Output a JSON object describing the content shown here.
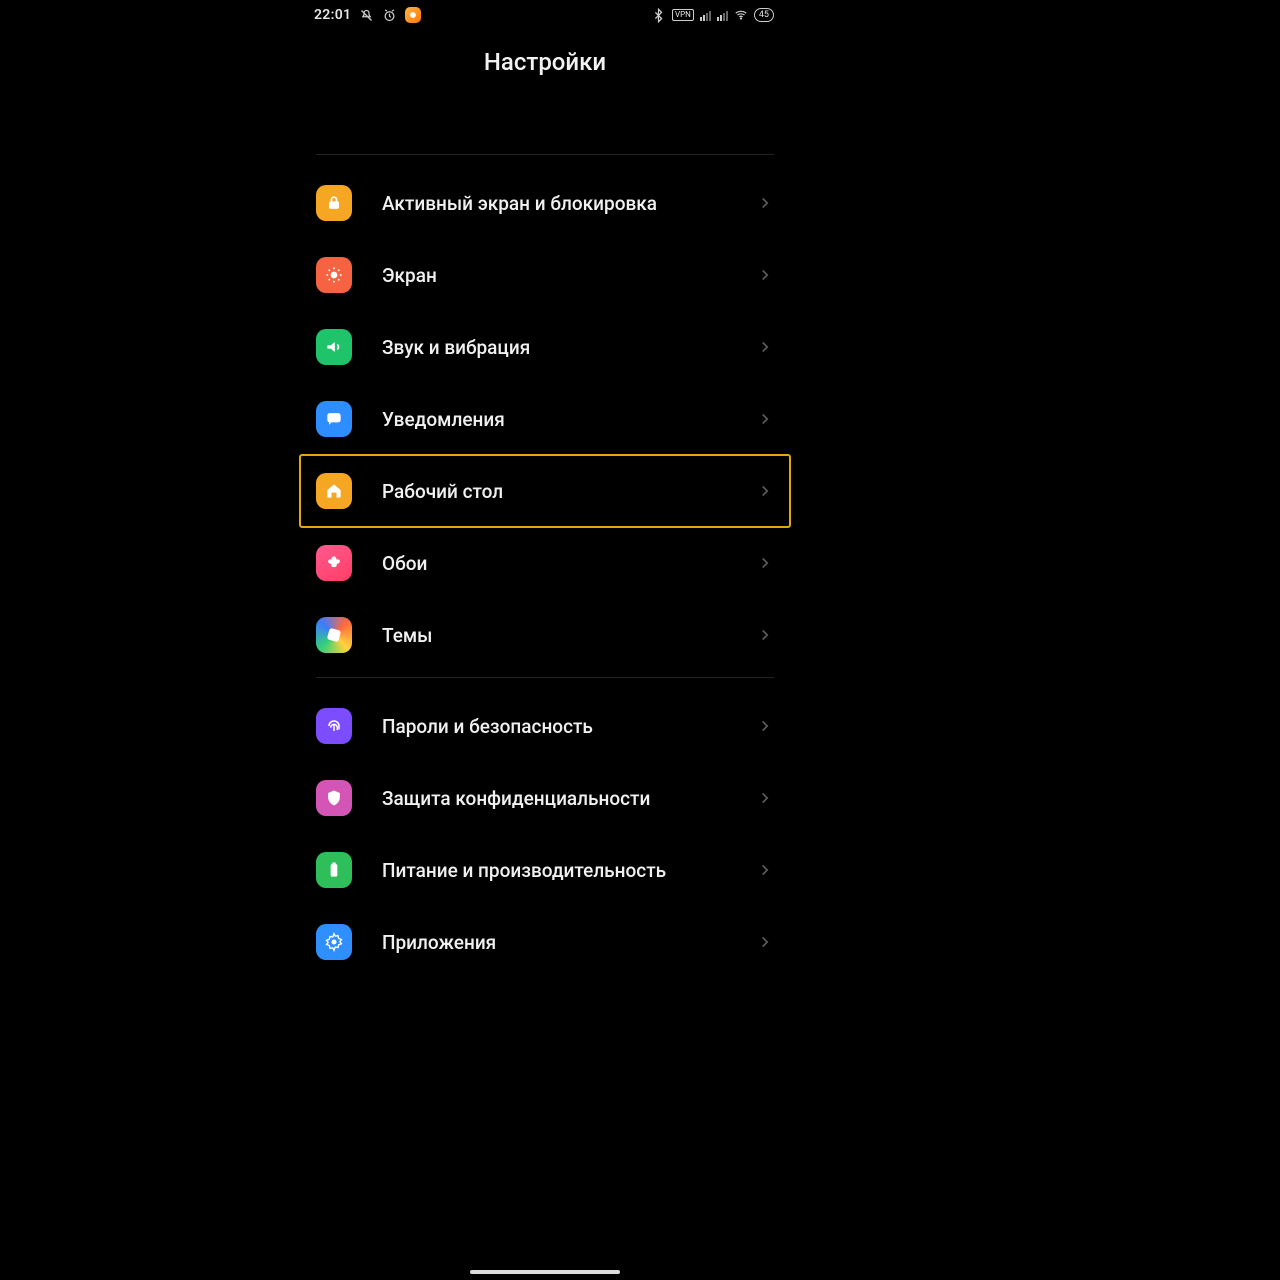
{
  "statusbar": {
    "time": "22:01",
    "battery": "45",
    "vpn": "VPN"
  },
  "page": {
    "title": "Настройки"
  },
  "groups": [
    {
      "items": [
        {
          "id": "aod",
          "label": "Активный экран и блокировка",
          "icon": "lock-icon",
          "iconClass": "bg-orange"
        },
        {
          "id": "display",
          "label": "Экран",
          "icon": "sun-icon",
          "iconClass": "bg-red"
        },
        {
          "id": "sound",
          "label": "Звук и вибрация",
          "icon": "volume-icon",
          "iconClass": "bg-green"
        },
        {
          "id": "notifications",
          "label": "Уведомления",
          "icon": "chat-icon",
          "iconClass": "bg-blue"
        },
        {
          "id": "home",
          "label": "Рабочий стол",
          "icon": "home-icon",
          "iconClass": "bg-orange",
          "highlight": true
        },
        {
          "id": "wallpaper",
          "label": "Обои",
          "icon": "flower-icon",
          "iconClass": "bg-pink"
        },
        {
          "id": "themes",
          "label": "Темы",
          "icon": "theme-icon",
          "iconClass": "bg-theme"
        }
      ]
    },
    {
      "items": [
        {
          "id": "passwords",
          "label": "Пароли и безопасность",
          "icon": "fingerprint-icon",
          "iconClass": "bg-purple"
        },
        {
          "id": "privacy",
          "label": "Защита конфиденциальности",
          "icon": "shield-icon",
          "iconClass": "bg-pink2"
        },
        {
          "id": "battery",
          "label": "Питание и производительность",
          "icon": "battery-icon",
          "iconClass": "bg-green2"
        },
        {
          "id": "apps",
          "label": "Приложения",
          "icon": "gear-icon",
          "iconClass": "bg-blue2"
        }
      ]
    }
  ]
}
